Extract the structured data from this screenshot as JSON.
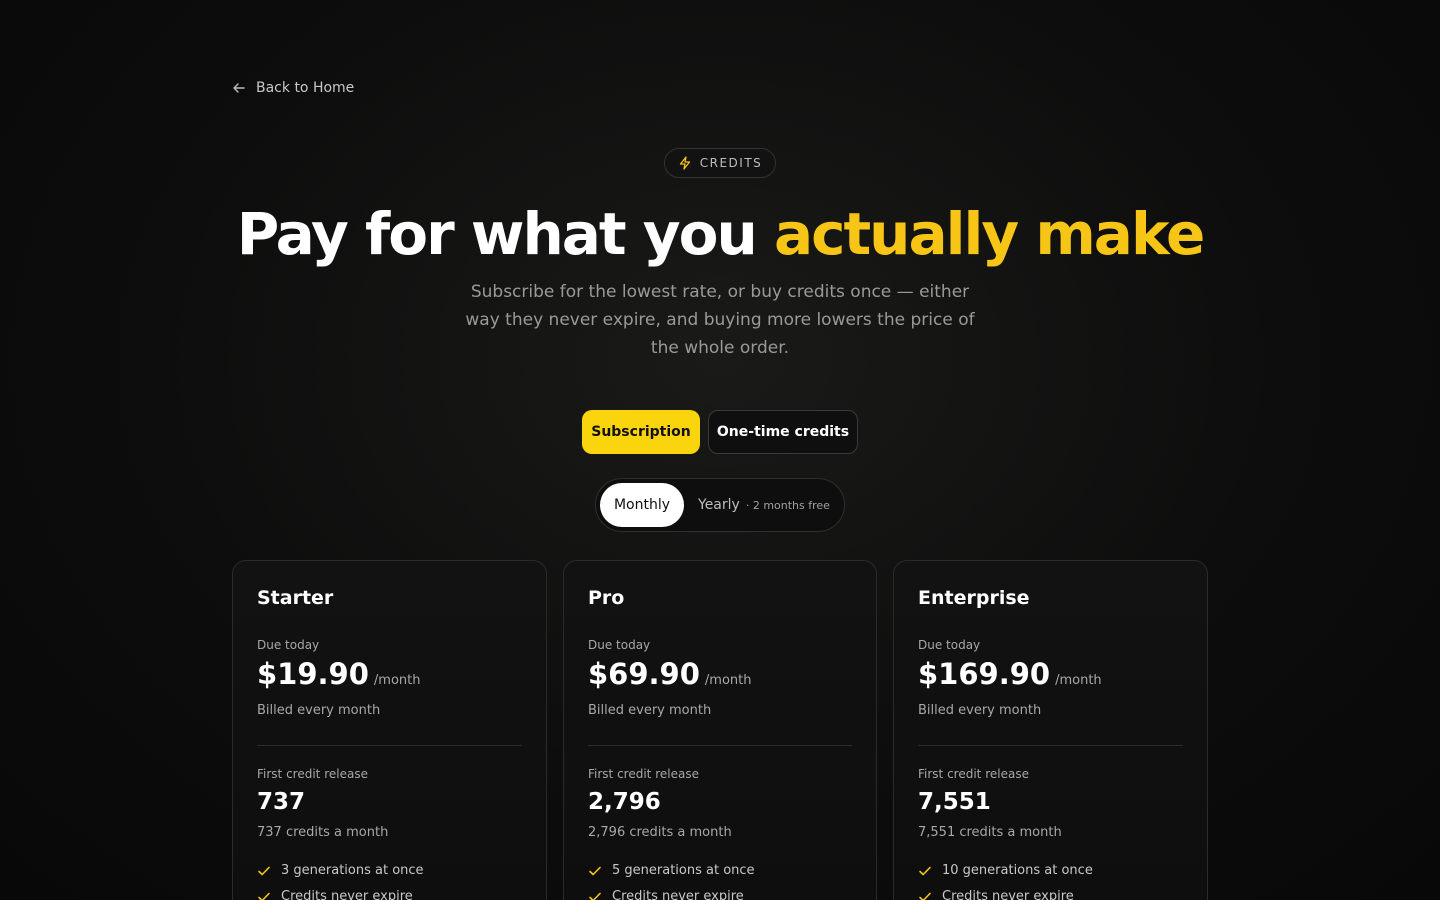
{
  "nav": {
    "back_label": "Back to Home",
    "back_icon": "arrow-left-icon"
  },
  "badge": {
    "label": "CREDITS",
    "icon": "lightning-icon"
  },
  "hero": {
    "title_main": "Pay for what you ",
    "title_accent": "actually make",
    "subtitle": "Subscribe for the lowest rate, or buy credits once — either way they never expire, and buying more lowers the price of the whole order."
  },
  "modes": {
    "subscription": "Subscription",
    "one_time": "One-time credits"
  },
  "period": {
    "monthly": "Monthly",
    "yearly": "Yearly",
    "yearly_note": "· 2 months free"
  },
  "colors": {
    "accent": "#fad40c",
    "background": "#0b0b0b"
  },
  "plans": [
    {
      "name": "Starter",
      "due_label": "Due today",
      "price": "$19.90",
      "per": "/month",
      "billed": "Billed every month",
      "release_label": "First credit release",
      "release_num": "737",
      "release_sub": "737 credits a month",
      "features": [
        "3 generations at once",
        "Credits never expire"
      ]
    },
    {
      "name": "Pro",
      "due_label": "Due today",
      "price": "$69.90",
      "per": "/month",
      "billed": "Billed every month",
      "release_label": "First credit release",
      "release_num": "2,796",
      "release_sub": "2,796 credits a month",
      "features": [
        "5 generations at once",
        "Credits never expire"
      ]
    },
    {
      "name": "Enterprise",
      "due_label": "Due today",
      "price": "$169.90",
      "per": "/month",
      "billed": "Billed every month",
      "release_label": "First credit release",
      "release_num": "7,551",
      "release_sub": "7,551 credits a month",
      "features": [
        "10 generations at once",
        "Credits never expire"
      ]
    }
  ]
}
